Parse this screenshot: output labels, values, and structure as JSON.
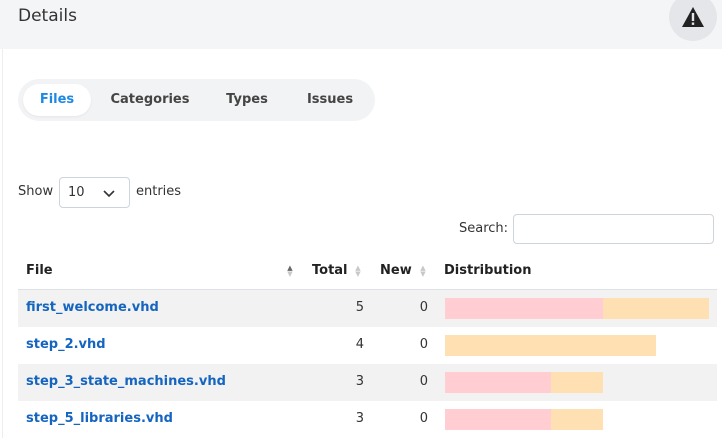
{
  "header": {
    "title": "Details",
    "alert_icon": "warning-icon"
  },
  "tabs": [
    {
      "label": "Files",
      "active": true
    },
    {
      "label": "Categories",
      "active": false
    },
    {
      "label": "Types",
      "active": false
    },
    {
      "label": "Issues",
      "active": false
    }
  ],
  "length": {
    "show_label": "Show",
    "selected": "10",
    "entries_label": "entries"
  },
  "search": {
    "label": "Search:",
    "value": "",
    "placeholder": ""
  },
  "table": {
    "columns": {
      "file": "File",
      "total": "Total",
      "new": "New",
      "distribution": "Distribution"
    },
    "rows": [
      {
        "file": "first_welcome.vhd",
        "total": "5",
        "new": "0",
        "distribution": [
          3,
          2
        ]
      },
      {
        "file": "step_2.vhd",
        "total": "4",
        "new": "0",
        "distribution": [
          0,
          4
        ]
      },
      {
        "file": "step_3_state_machines.vhd",
        "total": "3",
        "new": "0",
        "distribution": [
          2,
          1
        ]
      },
      {
        "file": "step_5_libraries.vhd",
        "total": "3",
        "new": "0",
        "distribution": [
          2,
          1
        ]
      }
    ],
    "distribution_max": 5
  },
  "colors": {
    "accent": "#1e88e5",
    "link": "#1565c0",
    "dist_high": "#ffcdd2",
    "dist_normal": "#ffe0b2"
  }
}
